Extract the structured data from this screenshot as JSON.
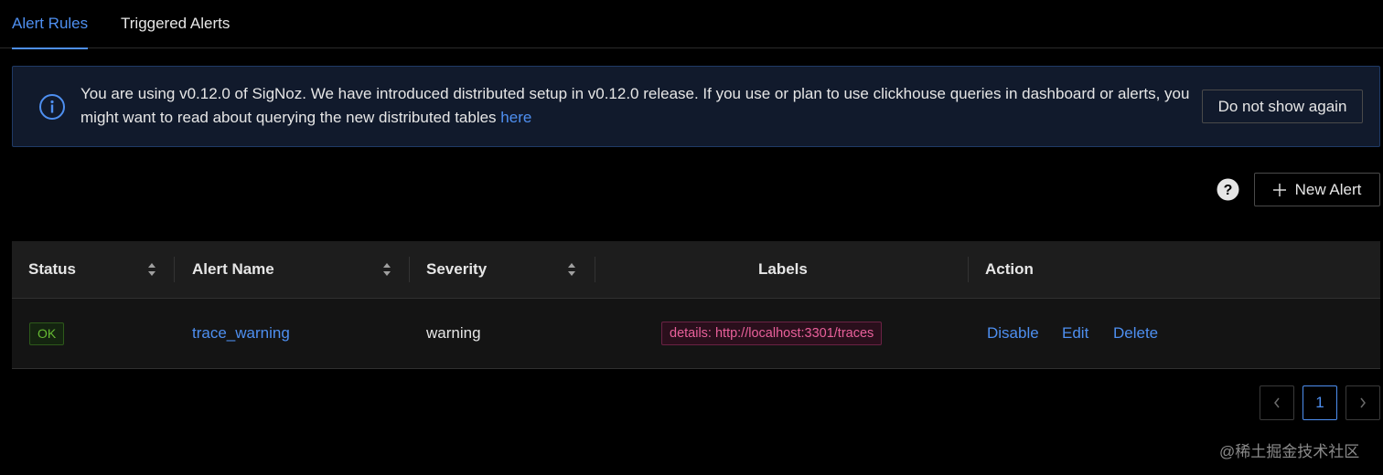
{
  "tabs": [
    {
      "label": "Alert Rules",
      "active": true
    },
    {
      "label": "Triggered Alerts",
      "active": false
    }
  ],
  "banner": {
    "icon": "info-circle-icon",
    "message": "You are using v0.12.0 of SigNoz. We have introduced distributed setup in v0.12.0 release. If you use or plan to use clickhouse queries in dashboard or alerts, you might want to read about querying the new distributed tables ",
    "link_text": "here",
    "dismiss_label": "Do not show again"
  },
  "toolbar": {
    "help_icon": "question-circle-icon",
    "new_alert_icon": "plus-icon",
    "new_alert_label": "New Alert"
  },
  "table": {
    "columns": [
      "Status",
      "Alert Name",
      "Severity",
      "Labels",
      "Action"
    ],
    "rows": [
      {
        "status": "OK",
        "alert_name": "trace_warning",
        "severity": "warning",
        "label": "details: http://localhost:3301/traces",
        "actions": [
          "Disable",
          "Edit",
          "Delete"
        ]
      }
    ]
  },
  "pagination": {
    "prev_icon": "chevron-left-icon",
    "current_page": "1",
    "next_icon": "chevron-right-icon"
  },
  "watermark": "@稀土掘金技术社区",
  "colors": {
    "accent": "#4e8ff0",
    "ok": "#66bb33",
    "label_tag": "#e8609a",
    "banner_bg": "#111a2c"
  }
}
